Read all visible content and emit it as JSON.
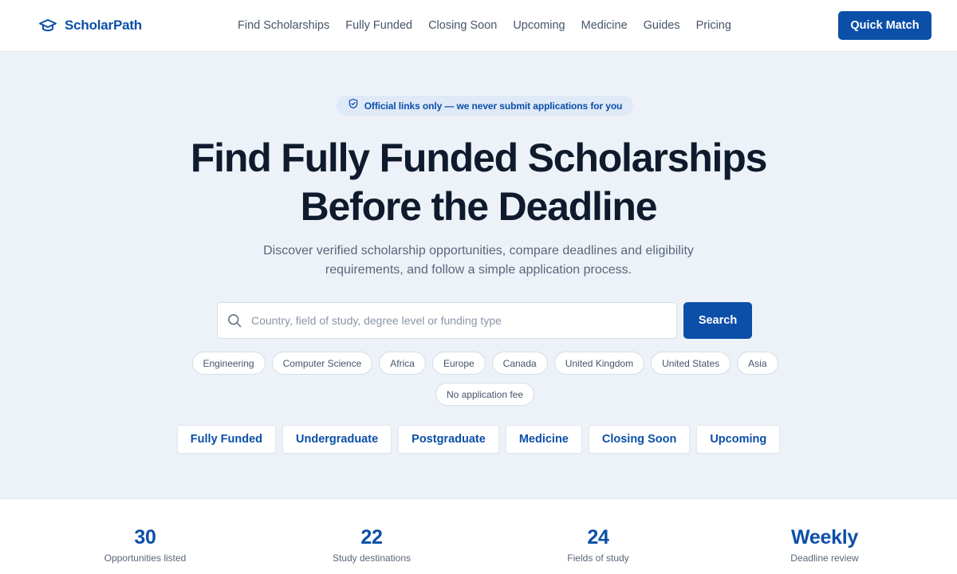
{
  "brand": {
    "name": "ScholarPath",
    "icon": "graduation-cap-icon"
  },
  "nav": {
    "links": [
      "Find Scholarships",
      "Fully Funded",
      "Closing Soon",
      "Upcoming",
      "Medicine",
      "Guides",
      "Pricing"
    ],
    "cta_label": "Quick Match"
  },
  "notice": {
    "icon": "shield-check-icon",
    "text": "Official links only — we never submit applications for you"
  },
  "hero": {
    "title_line1": "Find Fully Funded Scholarships",
    "title_line2": "Before the Deadline",
    "subtitle": "Discover verified scholarship opportunities, compare deadlines and eligibility requirements, and follow a simple application process."
  },
  "search": {
    "icon": "search-icon",
    "placeholder": "Country, field of study, degree level or funding type",
    "value": "",
    "button_label": "Search"
  },
  "chips": [
    "Engineering",
    "Computer Science",
    "Africa",
    "Europe",
    "Canada",
    "United Kingdom",
    "United States",
    "Asia",
    "No application fee"
  ],
  "categories": [
    "Fully Funded",
    "Undergraduate",
    "Postgraduate",
    "Medicine",
    "Closing Soon",
    "Upcoming"
  ],
  "stats": [
    {
      "value": "30",
      "label": "Opportunities listed"
    },
    {
      "value": "22",
      "label": "Study destinations"
    },
    {
      "value": "24",
      "label": "Fields of study"
    },
    {
      "value": "Weekly",
      "label": "Deadline review"
    }
  ],
  "colors": {
    "primary": "#0b4fa8",
    "background": "#edf2f9",
    "heading": "#0f1b2d",
    "muted": "#5a6679"
  }
}
